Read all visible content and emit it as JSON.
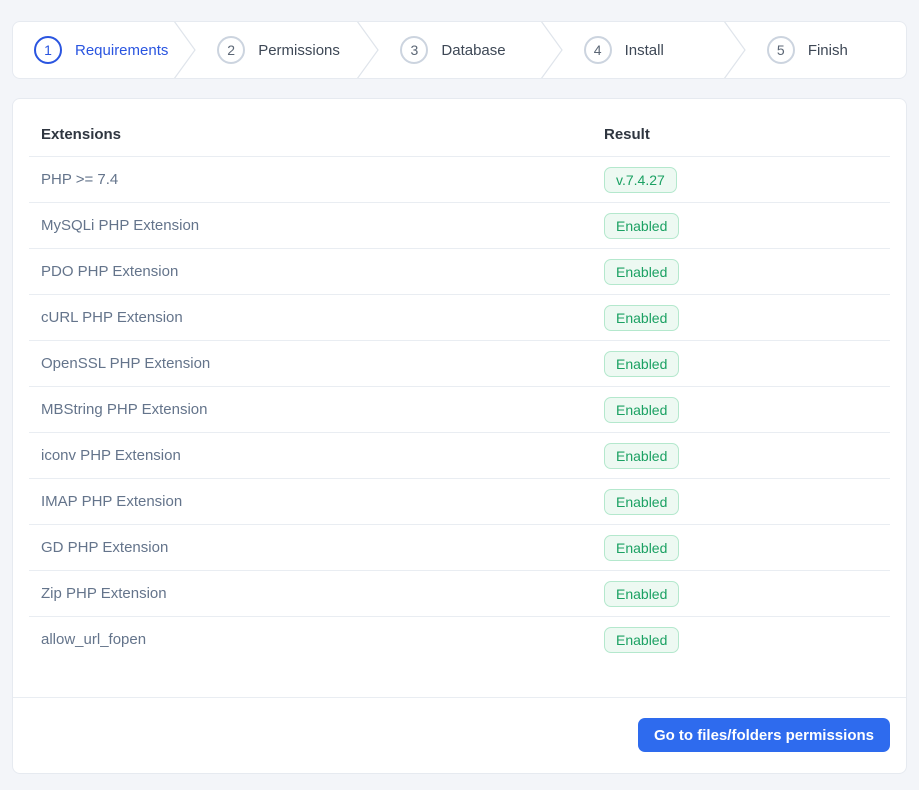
{
  "stepper": {
    "steps": [
      {
        "number": "1",
        "label": "Requirements",
        "active": true
      },
      {
        "number": "2",
        "label": "Permissions",
        "active": false
      },
      {
        "number": "3",
        "label": "Database",
        "active": false
      },
      {
        "number": "4",
        "label": "Install",
        "active": false
      },
      {
        "number": "5",
        "label": "Finish",
        "active": false
      }
    ]
  },
  "table": {
    "headers": {
      "extensions": "Extensions",
      "result": "Result"
    },
    "rows": [
      {
        "name": "PHP >= 7.4",
        "result": "v.7.4.27",
        "status": "success"
      },
      {
        "name": "MySQLi PHP Extension",
        "result": "Enabled",
        "status": "success"
      },
      {
        "name": "PDO PHP Extension",
        "result": "Enabled",
        "status": "success"
      },
      {
        "name": "cURL PHP Extension",
        "result": "Enabled",
        "status": "success"
      },
      {
        "name": "OpenSSL PHP Extension",
        "result": "Enabled",
        "status": "success"
      },
      {
        "name": "MBString PHP Extension",
        "result": "Enabled",
        "status": "success"
      },
      {
        "name": "iconv PHP Extension",
        "result": "Enabled",
        "status": "success"
      },
      {
        "name": "IMAP PHP Extension",
        "result": "Enabled",
        "status": "success"
      },
      {
        "name": "GD PHP Extension",
        "result": "Enabled",
        "status": "success"
      },
      {
        "name": "Zip PHP Extension",
        "result": "Enabled",
        "status": "success"
      },
      {
        "name": "allow_url_fopen",
        "result": "Enabled",
        "status": "success"
      }
    ]
  },
  "footer": {
    "next_button_label": "Go to files/folders permissions"
  },
  "colors": {
    "accent_blue": "#2a55e0",
    "button_blue": "#2e6bee",
    "badge_text": "#1ba163",
    "badge_bg": "#edf9f2",
    "badge_border": "#b4e8cd",
    "success": "#1ba163"
  }
}
